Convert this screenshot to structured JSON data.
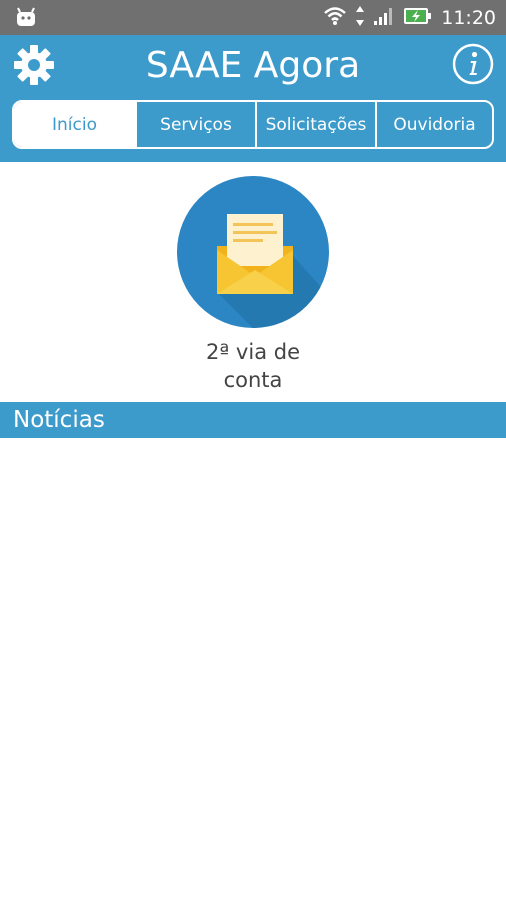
{
  "status_bar": {
    "time": "11:20",
    "icons": [
      "android-icon",
      "wifi-icon",
      "data-arrows-icon",
      "signal-icon",
      "battery-charging-icon"
    ]
  },
  "header": {
    "title": "SAAE Agora",
    "settings_icon": "gear-icon",
    "info_icon": "info-icon",
    "color": "#3d9bcc"
  },
  "tabs": [
    {
      "label": "Início",
      "active": true
    },
    {
      "label": "Serviços",
      "active": false
    },
    {
      "label": "Solicitações",
      "active": false
    },
    {
      "label": "Ouvidoria",
      "active": false
    }
  ],
  "feature": {
    "line1": "2ª via de",
    "line2": "conta",
    "icon": "envelope-icon"
  },
  "news": {
    "label": "Notícias"
  }
}
